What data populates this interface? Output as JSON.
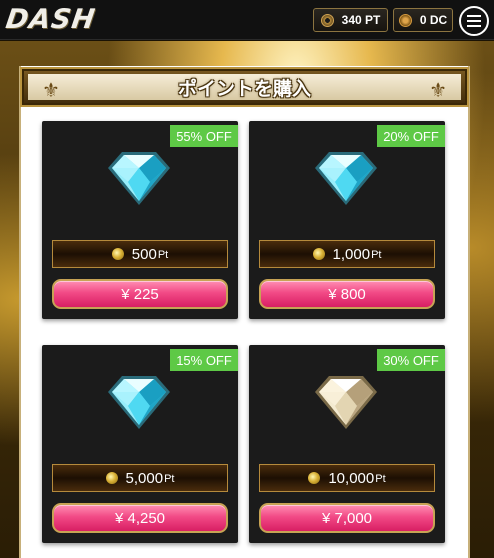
{
  "header": {
    "logo": "DASH",
    "points": "340 PT",
    "dc": "0 DC"
  },
  "panel": {
    "title": "ポイントを購入"
  },
  "cards": [
    {
      "discount": "55% OFF",
      "amount": "500",
      "unit": "Pt",
      "price": "¥ 225",
      "gem_color": "cyan"
    },
    {
      "discount": "20% OFF",
      "amount": "1,000",
      "unit": "Pt",
      "price": "¥ 800",
      "gem_color": "cyan"
    },
    {
      "discount": "15% OFF",
      "amount": "5,000",
      "unit": "Pt",
      "price": "¥ 4,250",
      "gem_color": "cyan"
    },
    {
      "discount": "30% OFF",
      "amount": "10,000",
      "unit": "Pt",
      "price": "¥ 7,000",
      "gem_color": "champagne"
    }
  ],
  "colors": {
    "badge_green": "#5ec946",
    "button_pink": "#f24a86",
    "gold_border": "#b58a3c"
  }
}
